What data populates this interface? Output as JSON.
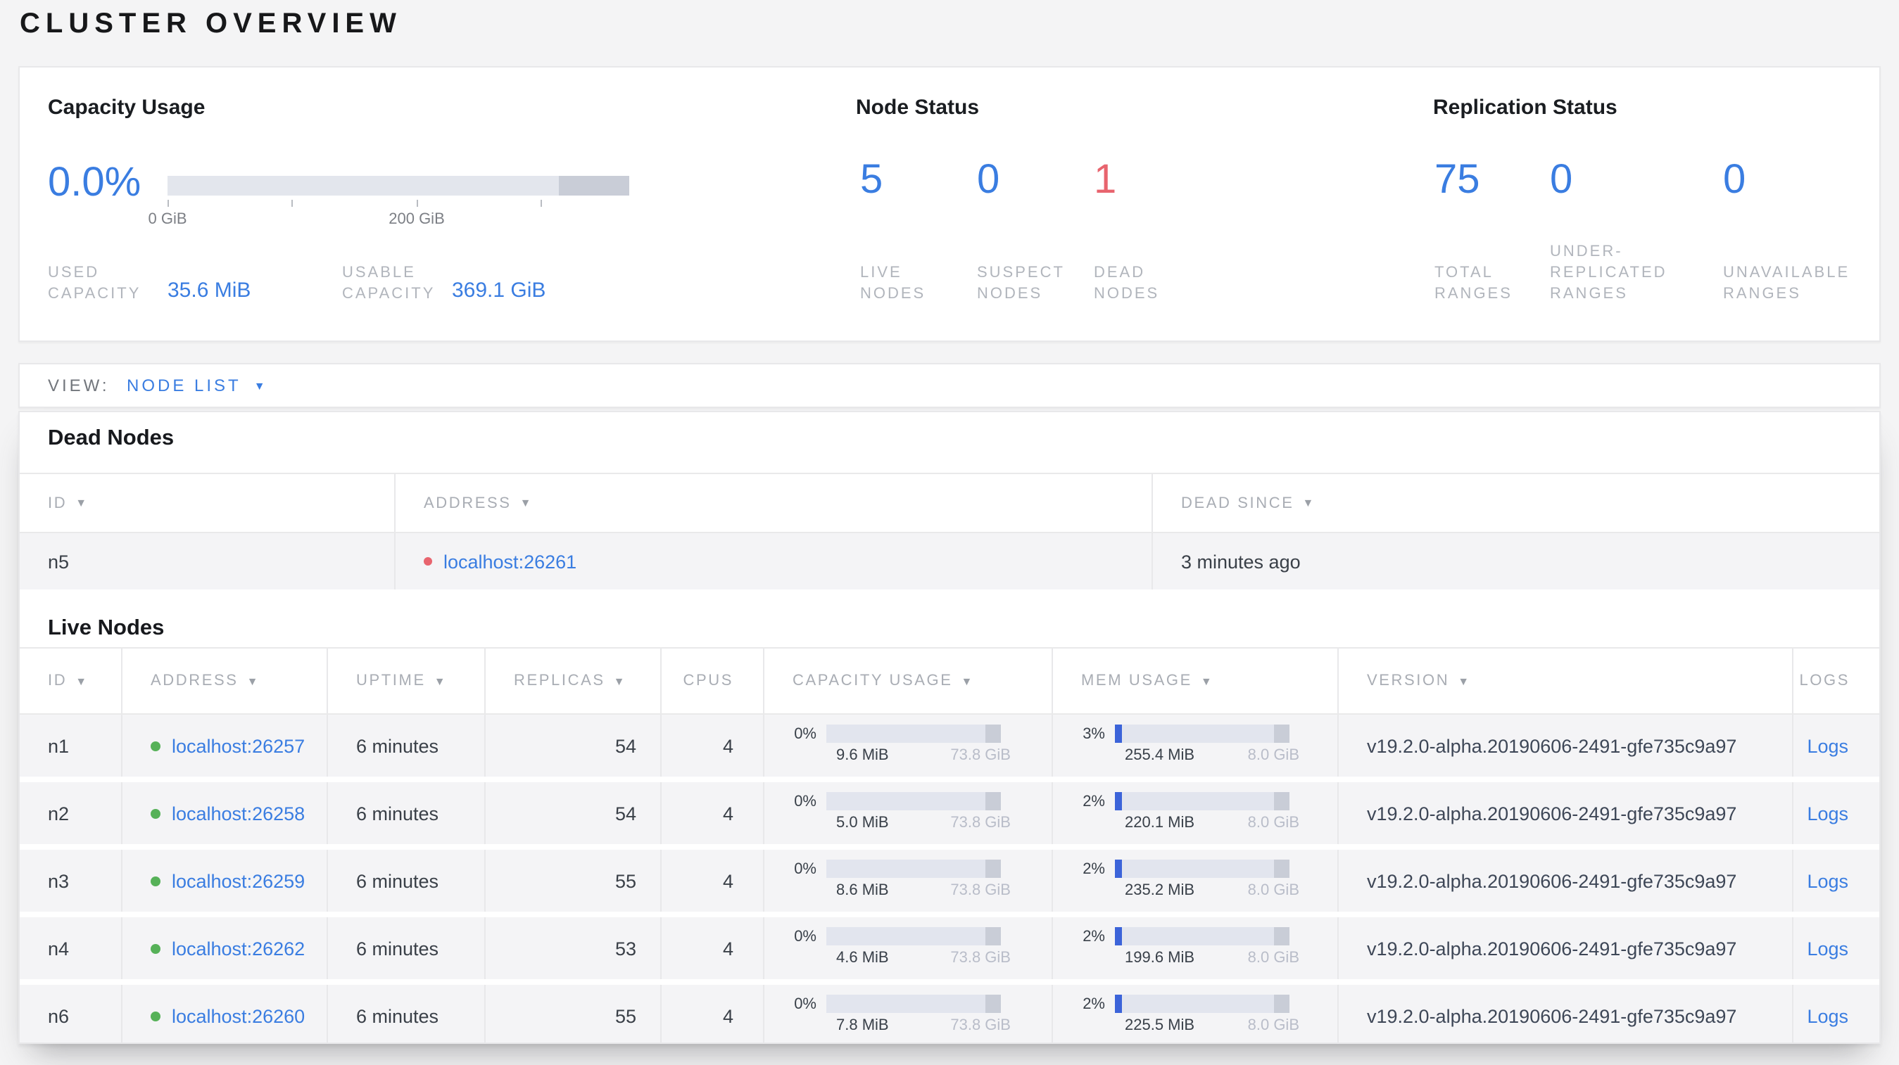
{
  "page_title": "CLUSTER OVERVIEW",
  "colors": {
    "accent_blue": "#3a7de1",
    "danger_red": "#e8646e",
    "live_green": "#56b158"
  },
  "summary": {
    "capacity": {
      "title": "Capacity Usage",
      "percent": "0.0%",
      "axis_ticks": [
        "0 GiB",
        "200 GiB"
      ],
      "stats": [
        {
          "label": "USED\nCAPACITY",
          "value": "35.6 MiB"
        },
        {
          "label": "USABLE\nCAPACITY",
          "value": "369.1 GiB"
        }
      ]
    },
    "node_status": {
      "title": "Node Status",
      "stats": [
        {
          "value": "5",
          "label": "LIVE\nNODES"
        },
        {
          "value": "0",
          "label": "SUSPECT\nNODES"
        },
        {
          "value": "1",
          "label": "DEAD\nNODES"
        }
      ]
    },
    "replication": {
      "title": "Replication Status",
      "stats": [
        {
          "value": "75",
          "label": "TOTAL\nRANGES"
        },
        {
          "value": "0",
          "label": "UNDER-\nREPLICATED\nRANGES"
        },
        {
          "value": "0",
          "label": "UNAVAILABLE\nRANGES"
        }
      ]
    }
  },
  "view_bar": {
    "label": "VIEW:",
    "selected": "NODE LIST"
  },
  "dead_nodes": {
    "title": "Dead Nodes",
    "columns": [
      {
        "label": "ID",
        "sort": true
      },
      {
        "label": "ADDRESS",
        "sort": true
      },
      {
        "label": "DEAD SINCE",
        "sort": true
      }
    ],
    "rows": [
      {
        "id": "n5",
        "address": "localhost:26261",
        "dead_since": "3 minutes ago"
      }
    ]
  },
  "live_nodes": {
    "title": "Live Nodes",
    "columns": [
      {
        "label": "ID",
        "sort": true
      },
      {
        "label": "ADDRESS",
        "sort": true
      },
      {
        "label": "UPTIME",
        "sort": true
      },
      {
        "label": "REPLICAS",
        "sort": true
      },
      {
        "label": "CPUS",
        "sort": false,
        "align": "right"
      },
      {
        "label": "CAPACITY USAGE",
        "sort": true
      },
      {
        "label": "MEM USAGE",
        "sort": true
      },
      {
        "label": "VERSION",
        "sort": true
      },
      {
        "label": "LOGS",
        "sort": false,
        "align": "right"
      }
    ],
    "rows": [
      {
        "id": "n1",
        "address": "localhost:26257",
        "uptime": "6 minutes",
        "replicas": "54",
        "cpus": "4",
        "capacity_pct": "0%",
        "capacity_used": "9.6 MiB",
        "capacity_total": "73.8 GiB",
        "mem_pct": "3%",
        "mem_used": "255.4 MiB",
        "mem_total": "8.0 GiB",
        "version": "v19.2.0-alpha.20190606-2491-gfe735c9a97",
        "logs_label": "Logs"
      },
      {
        "id": "n2",
        "address": "localhost:26258",
        "uptime": "6 minutes",
        "replicas": "54",
        "cpus": "4",
        "capacity_pct": "0%",
        "capacity_used": "5.0 MiB",
        "capacity_total": "73.8 GiB",
        "mem_pct": "2%",
        "mem_used": "220.1 MiB",
        "mem_total": "8.0 GiB",
        "version": "v19.2.0-alpha.20190606-2491-gfe735c9a97",
        "logs_label": "Logs"
      },
      {
        "id": "n3",
        "address": "localhost:26259",
        "uptime": "6 minutes",
        "replicas": "55",
        "cpus": "4",
        "capacity_pct": "0%",
        "capacity_used": "8.6 MiB",
        "capacity_total": "73.8 GiB",
        "mem_pct": "2%",
        "mem_used": "235.2 MiB",
        "mem_total": "8.0 GiB",
        "version": "v19.2.0-alpha.20190606-2491-gfe735c9a97",
        "logs_label": "Logs"
      },
      {
        "id": "n4",
        "address": "localhost:26262",
        "uptime": "6 minutes",
        "replicas": "53",
        "cpus": "4",
        "capacity_pct": "0%",
        "capacity_used": "4.6 MiB",
        "capacity_total": "73.8 GiB",
        "mem_pct": "2%",
        "mem_used": "199.6 MiB",
        "mem_total": "8.0 GiB",
        "version": "v19.2.0-alpha.20190606-2491-gfe735c9a97",
        "logs_label": "Logs"
      },
      {
        "id": "n6",
        "address": "localhost:26260",
        "uptime": "6 minutes",
        "replicas": "55",
        "cpus": "4",
        "capacity_pct": "0%",
        "capacity_used": "7.8 MiB",
        "capacity_total": "73.8 GiB",
        "mem_pct": "2%",
        "mem_used": "225.5 MiB",
        "mem_total": "8.0 GiB",
        "version": "v19.2.0-alpha.20190606-2491-gfe735c9a97",
        "logs_label": "Logs"
      }
    ]
  }
}
